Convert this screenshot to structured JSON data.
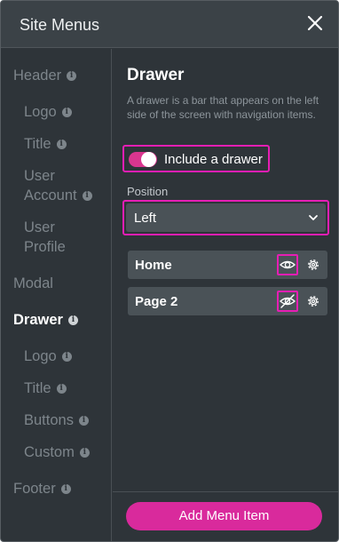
{
  "dialog": {
    "title": "Site Menus",
    "close_icon": "close-icon"
  },
  "sidebar": {
    "info_glyph": "i",
    "items": [
      {
        "label": "Header"
      },
      {
        "label": "Logo"
      },
      {
        "label": "Title"
      },
      {
        "label": "User Account"
      },
      {
        "label": "User Profile"
      },
      {
        "label": "Modal"
      },
      {
        "label": "Drawer",
        "active": true
      },
      {
        "label": "Logo"
      },
      {
        "label": "Title"
      },
      {
        "label": "Buttons"
      },
      {
        "label": "Custom"
      },
      {
        "label": "Footer"
      }
    ]
  },
  "main": {
    "heading": "Drawer",
    "description": "A drawer is a bar that appears on the left side of the screen with navigation items.",
    "include_toggle": {
      "label": "Include a drawer",
      "checked": true
    },
    "position": {
      "label": "Position",
      "value": "Left"
    },
    "menu_items": [
      {
        "label": "Home",
        "visibility_icon": "eye-icon"
      },
      {
        "label": "Page 2",
        "visibility_icon": "eye-slash-icon"
      }
    ],
    "add_button": "Add Menu Item"
  },
  "colors": {
    "accent": "#d92a9c",
    "highlight": "#e61eb4",
    "panel": "#2e3439"
  }
}
